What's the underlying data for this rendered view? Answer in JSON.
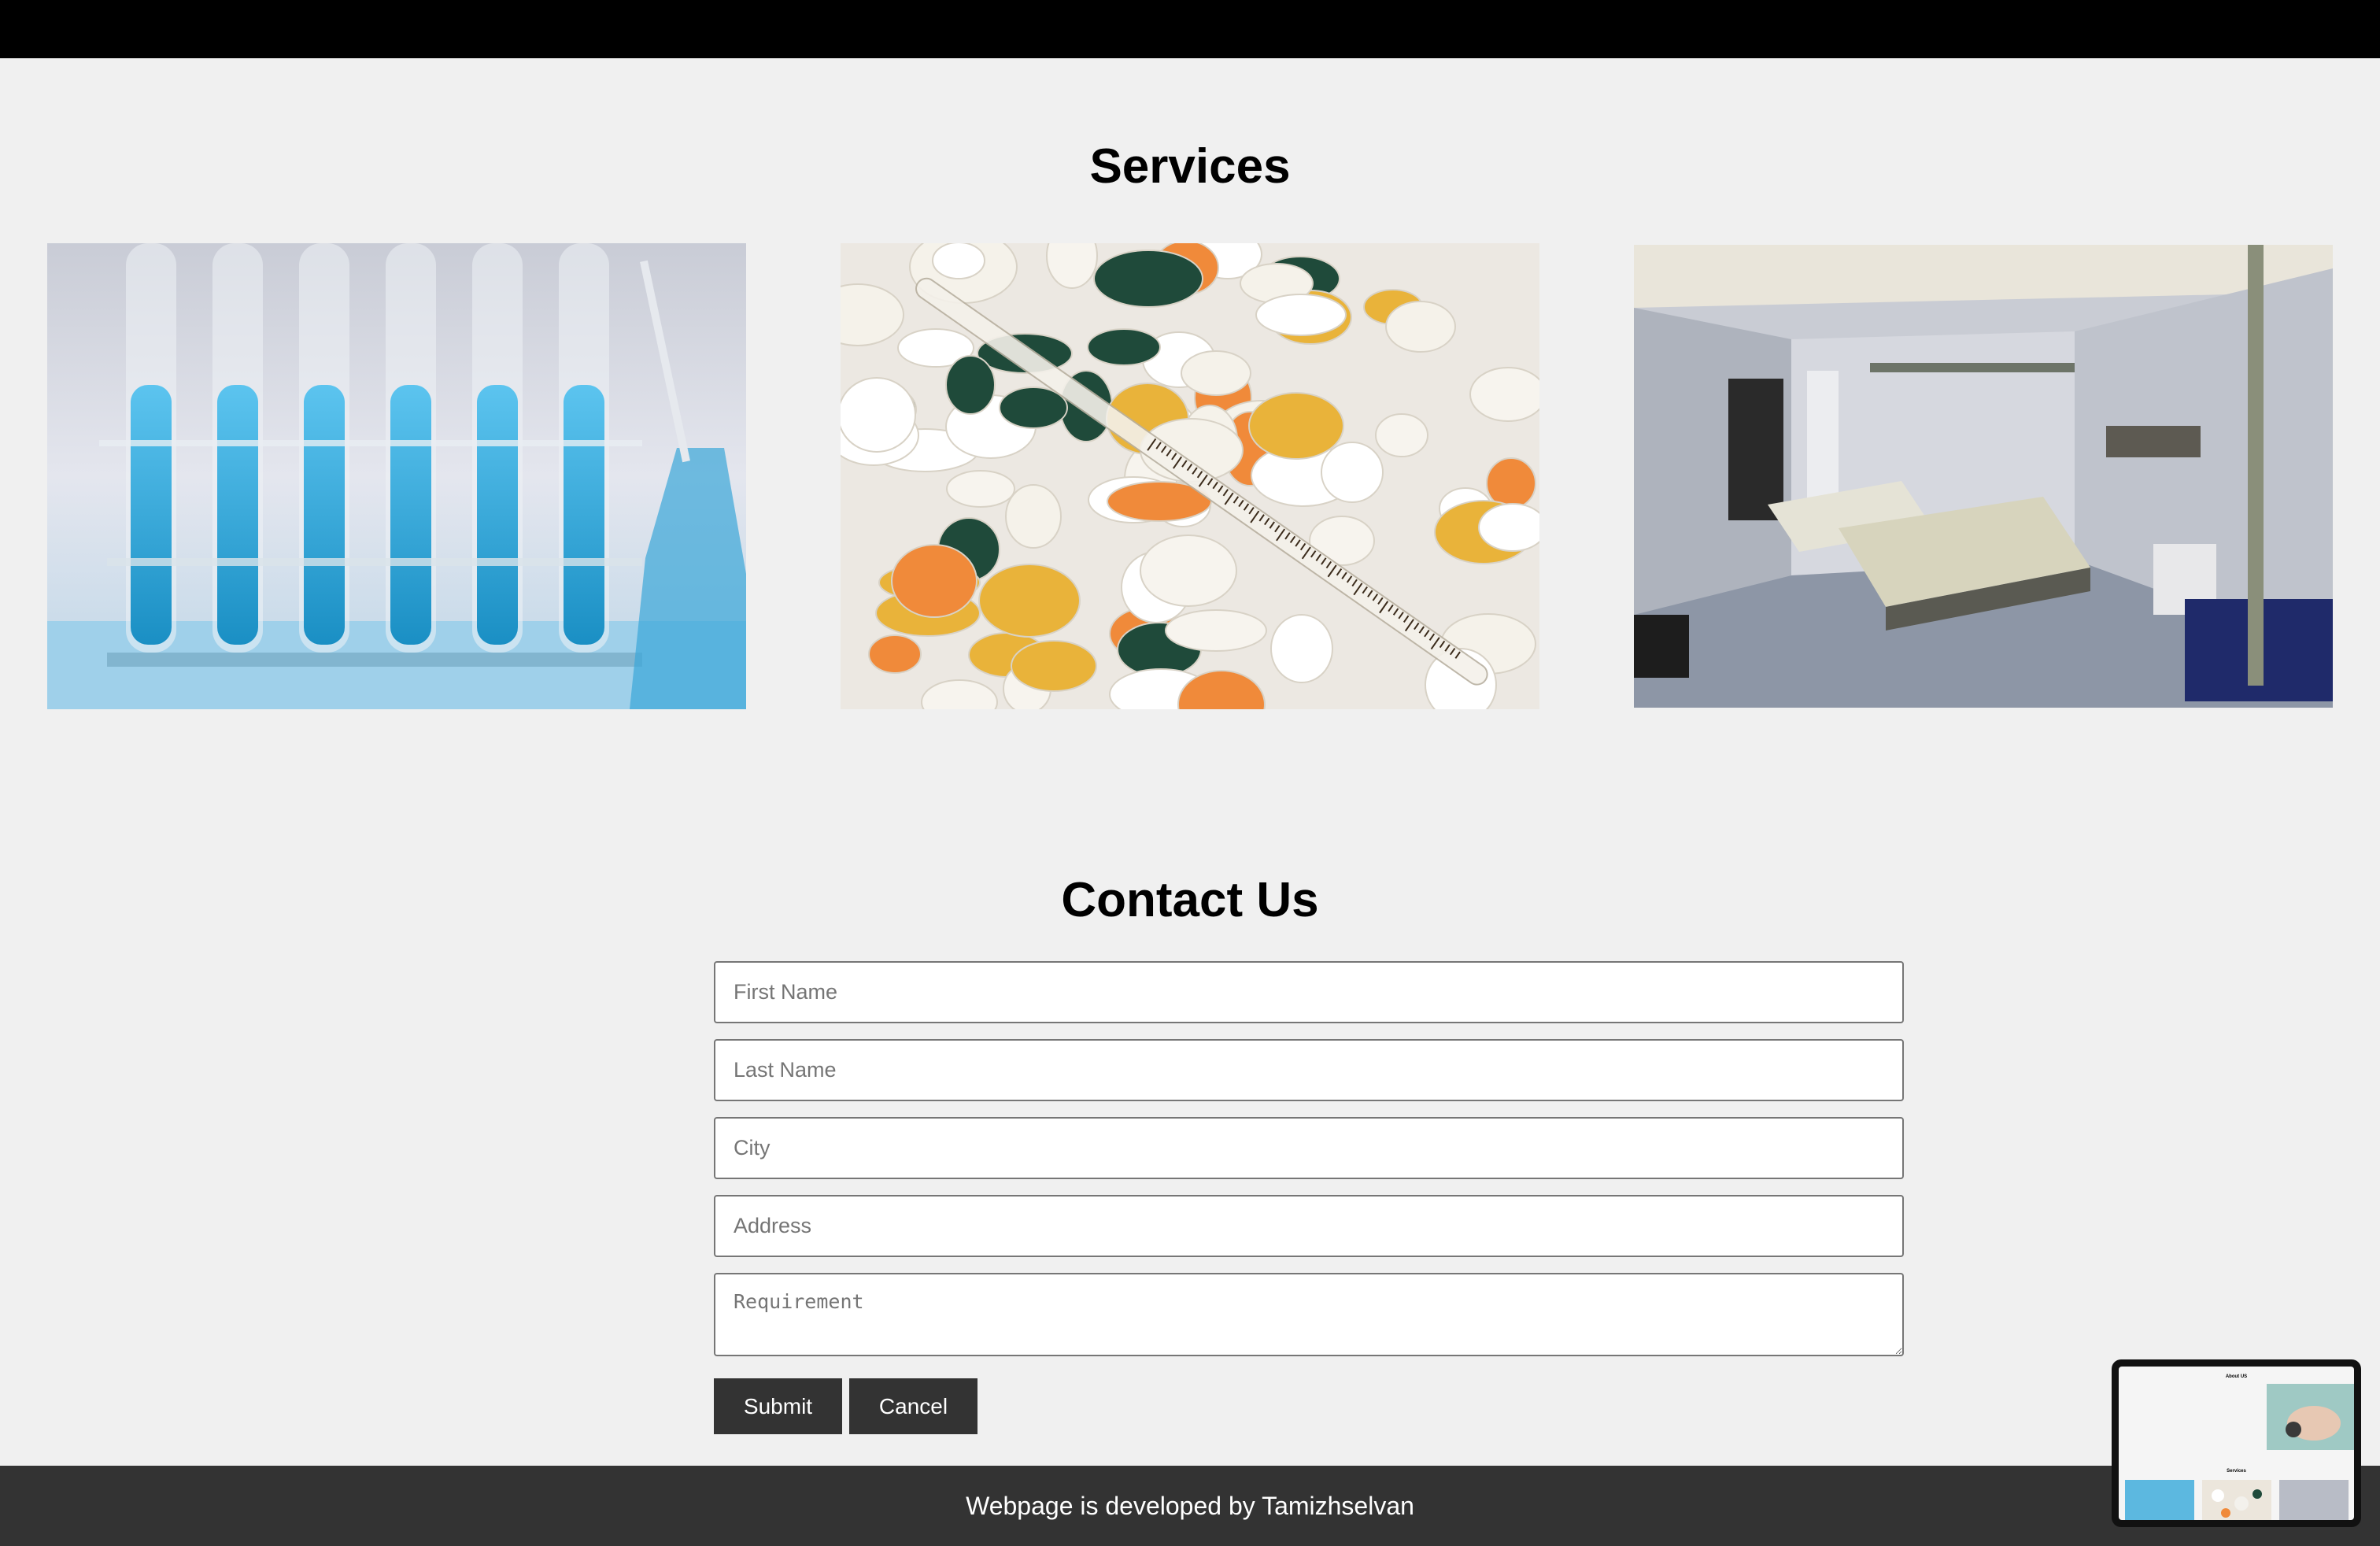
{
  "services": {
    "title": "Services",
    "images": [
      {
        "name": "lab-test-tubes-photo"
      },
      {
        "name": "pills-thermometer-photo"
      },
      {
        "name": "hospital-ward-photo"
      }
    ]
  },
  "contact": {
    "title": "Contact Us",
    "fields": {
      "first_name_placeholder": "First Name",
      "last_name_placeholder": "Last Name",
      "city_placeholder": "City",
      "address_placeholder": "Address",
      "requirement_placeholder": "Requirement"
    },
    "submit_label": "Submit",
    "cancel_label": "Cancel"
  },
  "footer": {
    "text": "Webpage is developed by Tamizhselvan"
  },
  "preview_thumbnail": {
    "about_title": "About US",
    "services_title": "Services"
  },
  "colors": {
    "topbar": "#000000",
    "background": "#f0f0f0",
    "button": "#333333",
    "footer": "#333333"
  }
}
